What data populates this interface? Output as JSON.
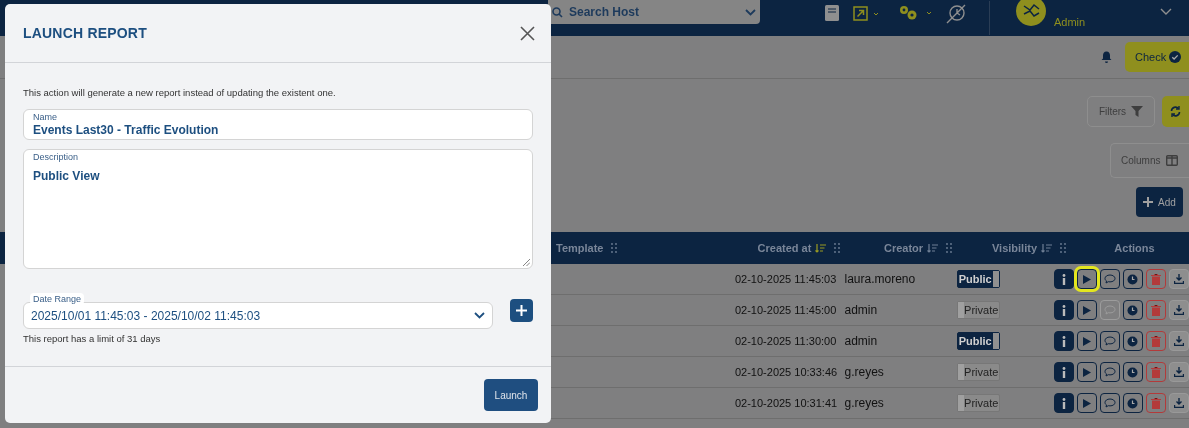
{
  "header": {
    "search": {
      "placeholder": "Search Host"
    },
    "user_role": "Admin"
  },
  "toolbar": {
    "check_button": "Check",
    "filters_button": "Filters",
    "columns_button": "Columns",
    "add_button": "Add"
  },
  "table": {
    "columns": [
      {
        "label": "Template",
        "handle": true
      },
      {
        "label": "Created at",
        "handle": true,
        "sorted": true
      },
      {
        "label": "Creator",
        "handle": true,
        "sorted": false
      },
      {
        "label": "Visibility",
        "handle": true,
        "sorted": false
      },
      {
        "label": "Actions",
        "handle": false
      }
    ],
    "rows": [
      {
        "created_at": "02-10-2025 11:45:03",
        "creator": "laura.moreno",
        "visibility": "Public",
        "on": true,
        "comment_disabled": false,
        "highlighted": true
      },
      {
        "created_at": "02-10-2025 11:45:00",
        "creator": "admin",
        "visibility": "Private",
        "on": false,
        "comment_disabled": true,
        "highlighted": false
      },
      {
        "created_at": "02-10-2025 11:30:00",
        "creator": "admin",
        "visibility": "Public",
        "on": true,
        "comment_disabled": false,
        "highlighted": false
      },
      {
        "created_at": "02-10-2025 10:33:46",
        "creator": "g.reyes",
        "visibility": "Private",
        "on": false,
        "comment_disabled": false,
        "highlighted": false
      },
      {
        "created_at": "02-10-2025 10:31:41",
        "creator": "g.reyes",
        "visibility": "Private",
        "on": false,
        "comment_disabled": false,
        "highlighted": false
      }
    ]
  },
  "modal": {
    "title": "LAUNCH REPORT",
    "notice": "This action will generate a new report instead of updating the existent one.",
    "fields": [
      {
        "kind": "input",
        "label": "Name",
        "value": "Events Last30 - Traffic Evolution"
      },
      {
        "kind": "textarea",
        "label": "Description",
        "value": "Public View"
      },
      {
        "kind": "select",
        "label": "Date Range",
        "value": "2025/10/01 11:45:03 - 2025/10/02 11:45:03",
        "hint": "This report has a limit of 31 days"
      }
    ],
    "launch_button": "Launch"
  }
}
